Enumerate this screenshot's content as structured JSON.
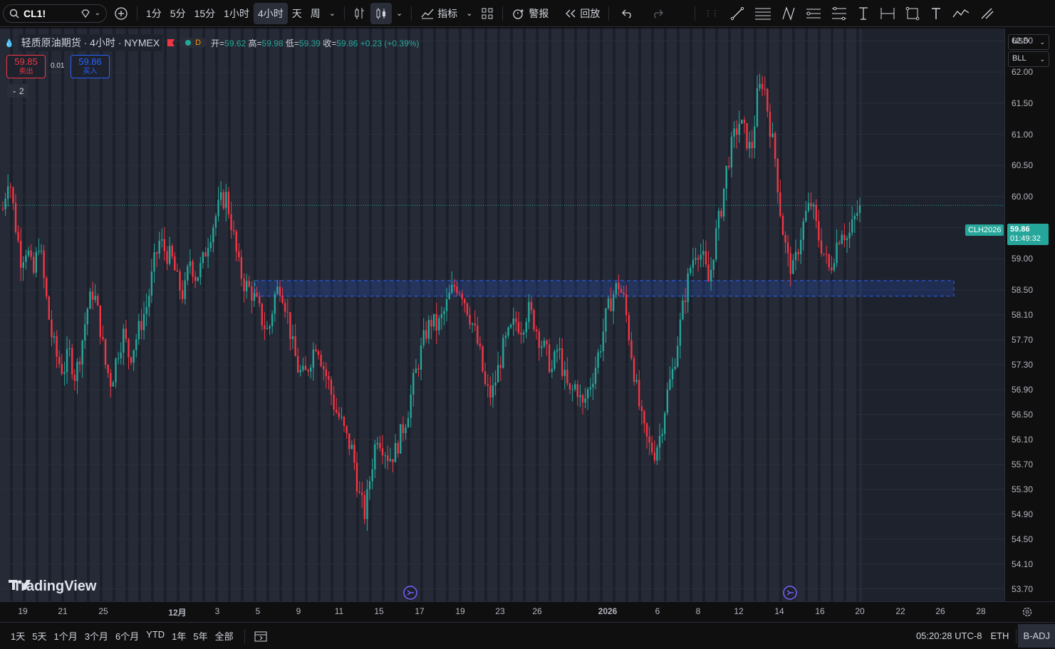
{
  "toolbar": {
    "symbol": "CL1!",
    "intervals": [
      "1分",
      "5分",
      "15分",
      "1小时",
      "4小时",
      "天",
      "周"
    ],
    "active_interval": "4小时",
    "indicators_label": "指标",
    "alert_label": "警报",
    "replay_label": "回放"
  },
  "legend": {
    "title": "轻质原油期货 · 4小时 · NYMEX",
    "badge": "D",
    "open_label": "开=",
    "open": "59.62",
    "high_label": "高=",
    "high": "59.98",
    "low_label": "低=",
    "low": "59.39",
    "close_label": "收=",
    "close": "59.86",
    "change": "+0.23 (+0.39%)",
    "sell_price": "59.85",
    "sell_label": "卖出",
    "spread": "0.01",
    "buy_price": "59.86",
    "buy_label": "买入",
    "collapse_count": "2"
  },
  "price_axis": {
    "currency": "USD",
    "unit": "BLL",
    "ticks": [
      "62.50",
      "62.00",
      "61.50",
      "61.00",
      "60.50",
      "60.00",
      "59.50",
      "59.00",
      "58.50",
      "58.10",
      "57.70",
      "57.30",
      "56.90",
      "56.50",
      "56.10",
      "55.70",
      "55.30",
      "54.90",
      "54.50",
      "54.10",
      "53.70"
    ],
    "contract_label": "CLH2026",
    "last_price": "59.86",
    "countdown": "01:49:32"
  },
  "time_axis": {
    "ticks": [
      "19",
      "21",
      "25",
      "12月",
      "3",
      "5",
      "9",
      "11",
      "15",
      "17",
      "19",
      "23",
      "26",
      "2026",
      "6",
      "8",
      "12",
      "14",
      "16",
      "20",
      "22",
      "26",
      "28"
    ]
  },
  "watermark": "TradingView",
  "bottom_bar": {
    "ranges": [
      "1天",
      "5天",
      "1个月",
      "3个月",
      "6个月",
      "YTD",
      "1年",
      "5年",
      "全部"
    ],
    "clock": "05:20:28 UTC-8",
    "session": "ETH",
    "adjust": "B-ADJ"
  },
  "colors": {
    "up": "#26a69a",
    "down": "#f23645",
    "accent": "#2962ff",
    "background": "#1e222d"
  },
  "chart_data": {
    "type": "candlestick",
    "symbol": "CL1!",
    "interval": "4小时",
    "ylim": [
      53.5,
      62.7
    ],
    "last": 59.86,
    "zone": [
      58.4,
      58.65
    ],
    "close_path": [
      59.8,
      60.4,
      59.6,
      59.0,
      59.2,
      58.7,
      59.3,
      58.5,
      57.8,
      57.4,
      57.2,
      57.5,
      57.1,
      57.6,
      58.2,
      58.5,
      58.0,
      57.3,
      57.0,
      57.5,
      57.8,
      57.4,
      57.7,
      58.0,
      58.3,
      58.9,
      59.3,
      59.1,
      59.0,
      58.6,
      58.4,
      59.0,
      58.7,
      58.9,
      59.3,
      59.6,
      59.9,
      60.0,
      59.5,
      58.9,
      58.6,
      58.5,
      58.3,
      58.0,
      57.8,
      58.4,
      58.6,
      58.2,
      57.6,
      57.2,
      57.1,
      57.4,
      57.7,
      57.3,
      57.0,
      56.6,
      56.4,
      56.1,
      55.9,
      55.2,
      54.9,
      55.6,
      56.2,
      56.0,
      55.8,
      55.9,
      56.2,
      56.5,
      57.0,
      57.4,
      57.8,
      58.0,
      57.9,
      58.1,
      58.4,
      58.6,
      58.5,
      58.2,
      57.9,
      57.5,
      56.9,
      56.8,
      57.2,
      57.6,
      57.8,
      58.0,
      57.9,
      58.2,
      58.0,
      57.7,
      57.5,
      57.2,
      57.6,
      57.1,
      56.8,
      57.0,
      56.6,
      56.9,
      57.2,
      57.6,
      58.1,
      58.4,
      58.6,
      58.3,
      57.6,
      56.9,
      56.3,
      56.0,
      55.9,
      56.2,
      56.8,
      57.2,
      57.8,
      58.4,
      58.9,
      59.2,
      59.0,
      58.6,
      59.3,
      59.8,
      60.5,
      60.9,
      61.2,
      61.0,
      60.7,
      61.6,
      61.9,
      61.2,
      60.6,
      59.6,
      59.0,
      58.8,
      59.3,
      59.7,
      59.9,
      59.4,
      59.1,
      58.8,
      59.2,
      59.5,
      59.3,
      59.6,
      59.86
    ]
  }
}
